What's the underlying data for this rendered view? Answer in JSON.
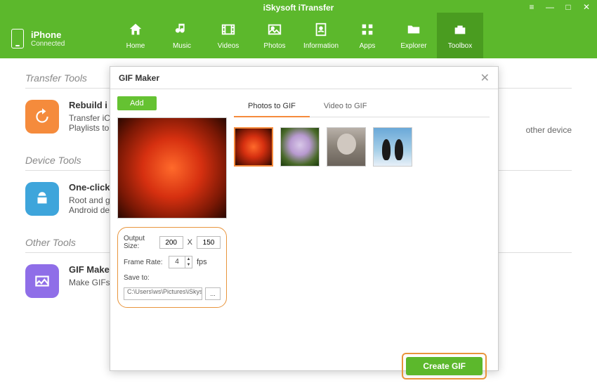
{
  "app": {
    "title": "iSkysoft iTransfer"
  },
  "device": {
    "name": "iPhone",
    "status": "Connected"
  },
  "nav": {
    "items": [
      {
        "label": "Home"
      },
      {
        "label": "Music"
      },
      {
        "label": "Videos"
      },
      {
        "label": "Photos"
      },
      {
        "label": "Information"
      },
      {
        "label": "Apps"
      },
      {
        "label": "Explorer"
      },
      {
        "label": "Toolbox"
      }
    ]
  },
  "sections": {
    "transfer": {
      "title": "Transfer Tools"
    },
    "device": {
      "title": "Device Tools"
    },
    "other": {
      "title": "Other Tools"
    }
  },
  "tools": {
    "rebuild": {
      "name": "Rebuild i",
      "desc1": "Transfer iC",
      "desc2": "Playlists to"
    },
    "oneclick": {
      "name": "One-click",
      "desc1": "Root and g",
      "desc2": "Android de"
    },
    "gifmaker": {
      "name": "GIF Make",
      "desc1": "Make GIFs"
    }
  },
  "right_hint": "other device",
  "dialog": {
    "title": "GIF Maker",
    "add_label": "Add",
    "tabs": {
      "photos": "Photos to GIF",
      "video": "Video to GIF"
    },
    "settings": {
      "output_label": "Output Size:",
      "width": "200",
      "x": "X",
      "height": "150",
      "frame_label": "Frame Rate:",
      "frame_value": "4",
      "fps": "fps",
      "save_label": "Save to:",
      "save_path": "C:\\Users\\ws\\Pictures\\iSkysoft iTr...",
      "browse": "..."
    },
    "create_label": "Create GIF"
  }
}
